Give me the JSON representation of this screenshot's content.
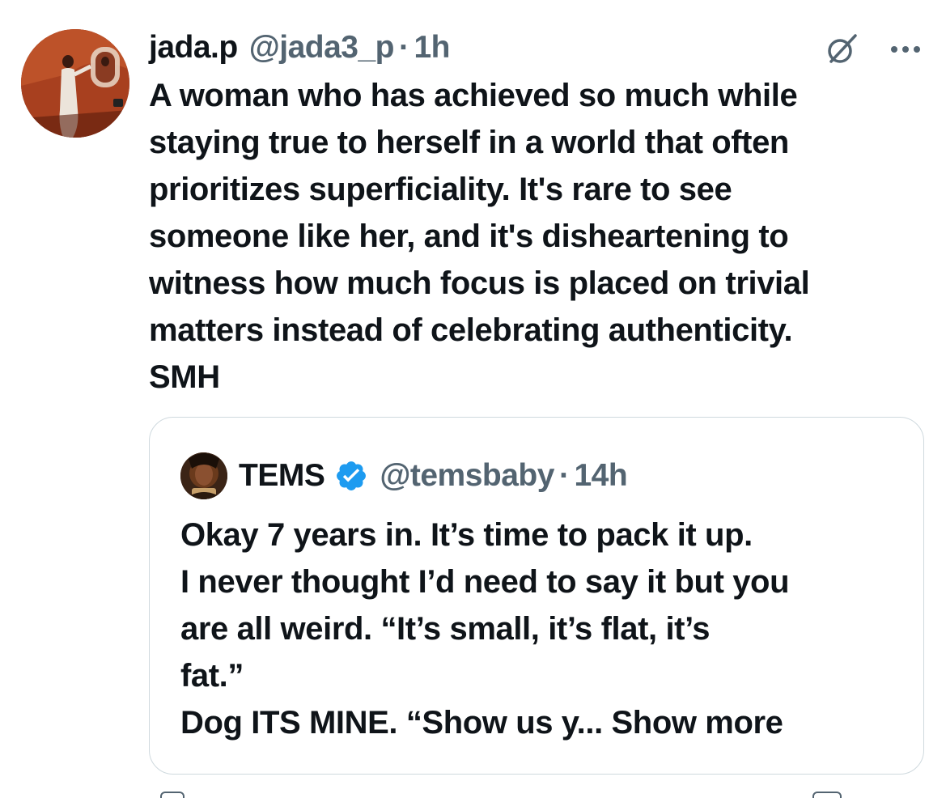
{
  "tweet": {
    "display_name": "jada.p",
    "handle": "@jada3_p",
    "dot": "·",
    "time": "1h",
    "text": "A woman who has achieved so much while\nstaying true to herself in a world that often\nprioritizes superficiality. It's rare to see\nsomeone like her, and it's disheartening to\nwitness how much focus is placed on trivial\nmatters instead of celebrating authenticity.\nSMH",
    "icons": {
      "grok": "grok-icon",
      "more": "more-icon"
    }
  },
  "quote": {
    "display_name": "TEMS",
    "verified": true,
    "handle": "@temsbaby",
    "dot": "·",
    "time": "14h",
    "text": "Okay 7 years in. It’s time to pack it up.\nI never thought I’d need to say it but you\nare all weird. “It’s small, it’s flat, it’s\nfat.”\nDog ITS MINE. “Show us y... ",
    "show_more": "Show more"
  },
  "colors": {
    "text_primary": "#0f1419",
    "text_secondary": "#536471",
    "border": "#cfd9de",
    "verified_blue": "#1d9bf0"
  }
}
